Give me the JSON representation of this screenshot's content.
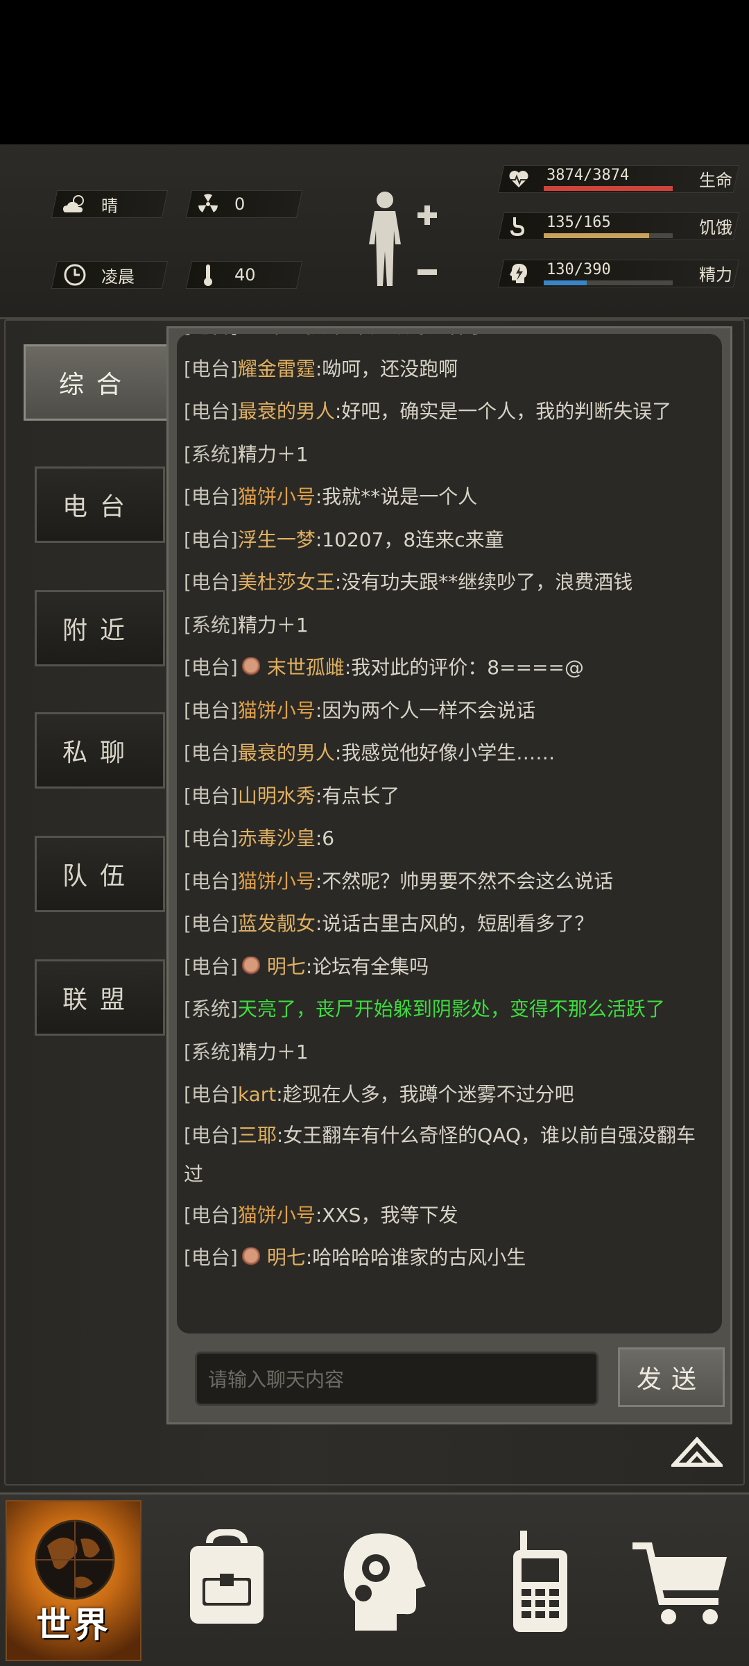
{
  "status": {
    "weather": {
      "icon": "cloud-sun-icon",
      "label": "晴"
    },
    "radiation": {
      "icon": "radiation-icon",
      "value": "0"
    },
    "time": {
      "icon": "clock-icon",
      "label": "凌晨"
    },
    "temperature": {
      "icon": "thermometer-icon",
      "value": "40"
    },
    "bars": [
      {
        "icon": "heart-icon",
        "value": "3874/3874",
        "name": "生命",
        "fraction": 1.0,
        "color": "#d0433a"
      },
      {
        "icon": "stomach-icon",
        "value": "135/165",
        "name": "饥饿",
        "fraction": 0.818,
        "color": "#c8a25c"
      },
      {
        "icon": "brain-energy-icon",
        "value": "130/390",
        "name": "精力",
        "fraction": 0.333,
        "color": "#3a84c8"
      }
    ]
  },
  "tabs": [
    {
      "label": "综合",
      "active": true
    },
    {
      "label": "电台",
      "active": false
    },
    {
      "label": "附近",
      "active": false
    },
    {
      "label": "私聊",
      "active": false
    },
    {
      "label": "队伍",
      "active": false
    },
    {
      "label": "联盟",
      "active": false
    }
  ],
  "messages": [
    {
      "channel": "[电台]",
      "badge": true,
      "name": "末世孤雌",
      "text": ":不是跟踪这样了"
    },
    {
      "channel": "[电台]",
      "name": "耀金雷霆",
      "text": ":呦呵，还没跑啊"
    },
    {
      "channel": "[电台]",
      "name": "最衰的男人",
      "text": ":好吧，确实是一个人，我的判断失误了"
    },
    {
      "channel": "[系统]",
      "text": "精力＋1"
    },
    {
      "channel": "[电台]",
      "name": "猫饼小号",
      "alt": true,
      "text": ":我就**说是一个人"
    },
    {
      "channel": "[电台]",
      "name": "浮生一梦",
      "text": ":10207，8连来c来童"
    },
    {
      "channel": "[电台]",
      "name": "美杜莎女王",
      "text": ":没有功夫跟**继续吵了，浪费酒钱"
    },
    {
      "channel": "[系统]",
      "text": "精力＋1"
    },
    {
      "channel": "[电台]",
      "badge": true,
      "name": "末世孤雌",
      "text": ":我对此的评价：8====@"
    },
    {
      "channel": "[电台]",
      "name": "猫饼小号",
      "alt": true,
      "text": ":因为两个人一样不会说话"
    },
    {
      "channel": "[电台]",
      "name": "最衰的男人",
      "text": ":我感觉他好像小学生……"
    },
    {
      "channel": "[电台]",
      "name": "山明水秀",
      "text": ":有点长了"
    },
    {
      "channel": "[电台]",
      "name": "赤毒沙皇",
      "text": ":6"
    },
    {
      "channel": "[电台]",
      "name": "猫饼小号",
      "alt": true,
      "text": ":不然呢？帅男要不然不会这么说话"
    },
    {
      "channel": "[电台]",
      "name": "蓝发靓女",
      "text": ":说话古里古风的，短剧看多了？"
    },
    {
      "channel": "[电台]",
      "badge": true,
      "name": "明七",
      "text": ":论坛有全集吗"
    },
    {
      "channel": "[系统]",
      "green": true,
      "text": "天亮了，丧尸开始躲到阴影处，变得不那么活跃了"
    },
    {
      "channel": "[系统]",
      "text": "精力＋1"
    },
    {
      "channel": "[电台]",
      "name": "kart",
      "text": ":趁现在人多，我蹲个迷雾不过分吧"
    },
    {
      "channel": "[电台]",
      "name": "三耶",
      "wrap": true,
      "text": ":女王翻车有什么奇怪的QAQ，谁以前自强没翻车过"
    },
    {
      "channel": "[电台]",
      "name": "猫饼小号",
      "alt": true,
      "text": ":XXS，我等下发"
    },
    {
      "channel": "[电台]",
      "badge": true,
      "name": "明七",
      "text": ":哈哈哈哈谁家的古风小生"
    }
  ],
  "chat_input": {
    "placeholder": "请输入聊天内容"
  },
  "send_label": "发送",
  "nav": {
    "world_label": "世界",
    "items": [
      "backpack-icon",
      "skills-head-icon",
      "radio-icon",
      "shop-cart-icon"
    ]
  }
}
